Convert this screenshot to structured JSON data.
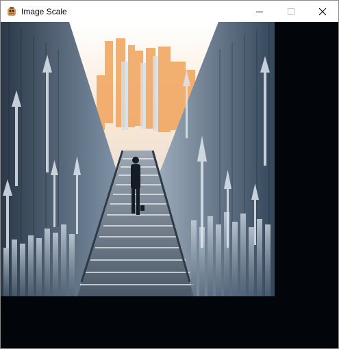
{
  "window": {
    "title": "Image Scale",
    "app_icon": "app-icon",
    "controls": {
      "minimize_icon": "minimize-icon",
      "maximize_icon": "maximize-icon",
      "close_icon": "close-icon"
    }
  },
  "client": {
    "background": "#02050a",
    "image": {
      "subject": "businessman-climbing-stairs-city"
    }
  }
}
